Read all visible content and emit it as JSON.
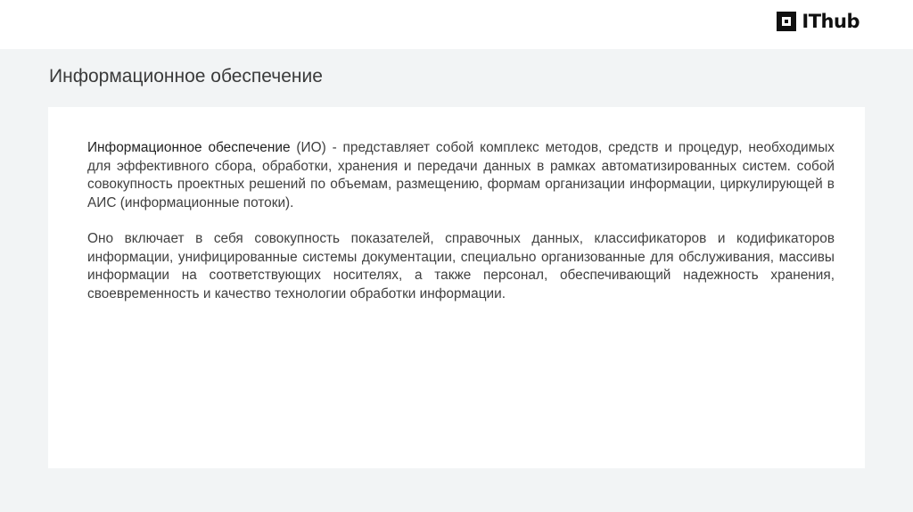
{
  "header": {
    "logo_text": "IThub",
    "logo_icon": "ithub-square-logo"
  },
  "slide": {
    "title": "Информационное обеспечение",
    "paragraph1_term": "Информационное обеспечение",
    "paragraph1_rest": " (ИО) - представляет собой комплекс методов, средств и процедур, необходимых для эффективного сбора, обработки, хранения и передачи данных в рамках автоматизированных систем. собой совокупность проектных решений по объемам, размещению, формам организации информации, циркулирующей в АИС (информационные потоки).",
    "paragraph2": "Оно включает в себя совокупность показателей, справочных данных, классификаторов и кодификаторов информации, унифицированные системы документации, специально организованные для обслуживания, массивы информации на соответствующих носителях, а также персонал, обеспечивающий надежность хранения, своевременность и качество технологии обработки информации."
  }
}
